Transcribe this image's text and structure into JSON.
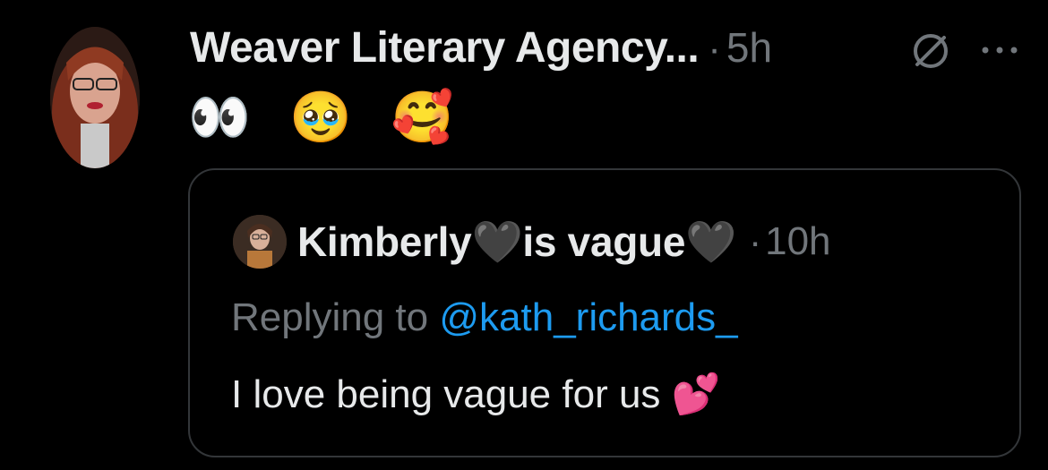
{
  "tweet": {
    "author_name": "Weaver Literary Agency...",
    "separator": "·",
    "time": "5h",
    "text": "👀 🥹 🥰",
    "icons": [
      "no-entry-icon",
      "more-icon"
    ]
  },
  "quote": {
    "author_name": "Kimberly🖤is vague🖤",
    "separator": "·",
    "time": "10h",
    "replying_prefix": "Replying to ",
    "replying_handle": "@kath_richards_",
    "text": "I love being vague for us 💕"
  },
  "colors": {
    "background": "#000000",
    "primary_text": "#e7e9ea",
    "secondary_text": "#71767b",
    "link": "#1d9bf0",
    "card_border": "#333639"
  }
}
